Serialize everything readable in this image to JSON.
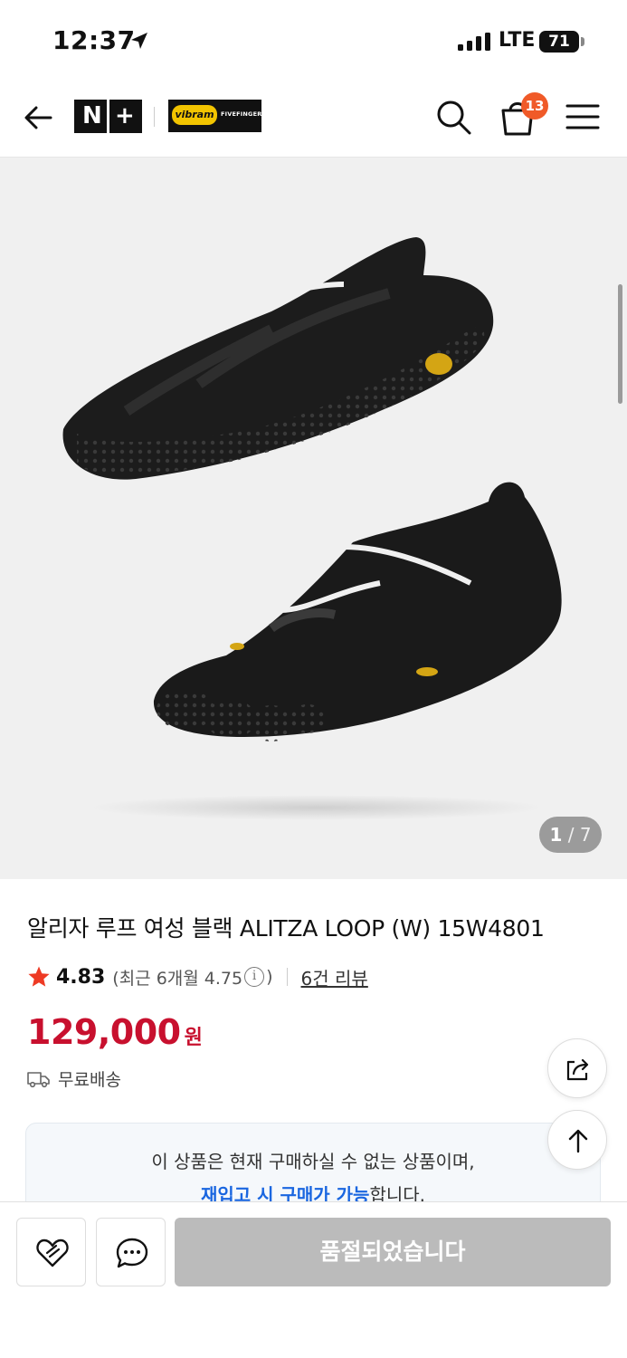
{
  "status_bar": {
    "time": "12:37",
    "network": "LTE",
    "battery": "71"
  },
  "header": {
    "store_logo": "N+",
    "brand_logo_badge": "vibram",
    "brand_logo_text": "FIVEFINGERS",
    "cart_count": "13"
  },
  "gallery": {
    "current": "1",
    "separator": "/",
    "total": "7",
    "image_alt": "Vibram Alitza Loop black barefoot shoes"
  },
  "product": {
    "title": "알리자 루프 여성 블랙 ALITZA LOOP (W) 15W4801",
    "rating": "4.83",
    "recent_rating_prefix": "(최근 6개월 4.75",
    "recent_rating_suffix": ")",
    "info_icon": "i",
    "review_link": "6건 리뷰",
    "price": "129,000",
    "currency": "원",
    "shipping": "무료배송"
  },
  "notice": {
    "line1": "이 상품은 현재 구매하실 수 없는 상품이며,",
    "line2_highlight": "재입고 시 구매가 가능",
    "line2_rest": "합니다."
  },
  "bottom_bar": {
    "soldout_label": "품절되었습니다"
  },
  "colors": {
    "price": "#c8102e",
    "badge": "#f05a28",
    "highlight": "#1a66e0",
    "star": "#ee3a24"
  }
}
